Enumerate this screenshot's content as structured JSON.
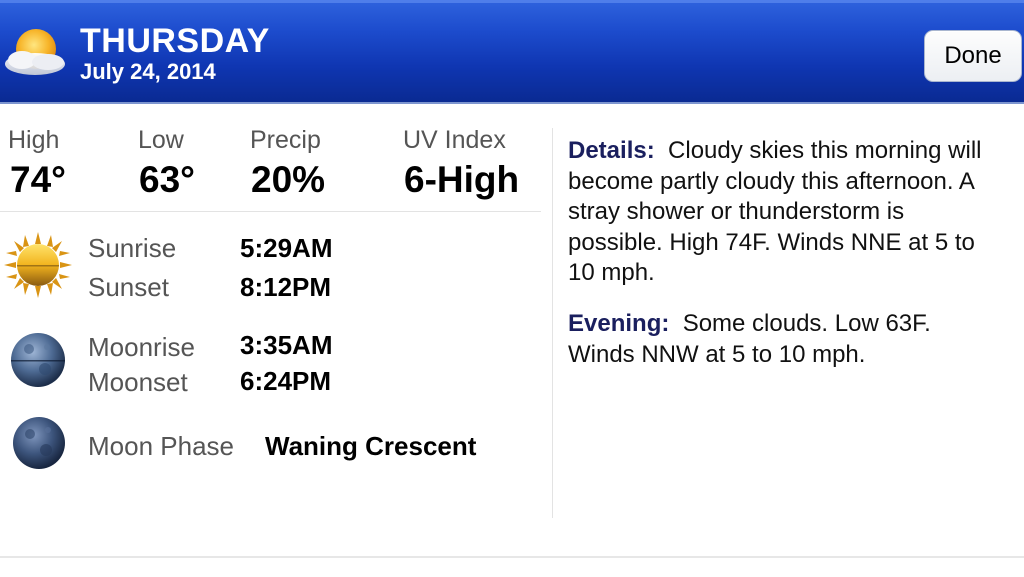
{
  "header": {
    "day": "THURSDAY",
    "date": "July 24, 2014",
    "done_label": "Done",
    "icon": "partly-cloudy-icon"
  },
  "stats": [
    {
      "label": "High",
      "value": "74°"
    },
    {
      "label": "Low",
      "value": "63°"
    },
    {
      "label": "Precip",
      "value": "20%"
    },
    {
      "label": "UV Index",
      "value": "6-High"
    }
  ],
  "sun": {
    "icon": "sun-icon",
    "sunrise_label": "Sunrise",
    "sunrise_value": "5:29AM",
    "sunset_label": "Sunset",
    "sunset_value": "8:12PM"
  },
  "moon": {
    "icon": "moon-icon",
    "moonrise_label": "Moonrise",
    "moonrise_value": "3:35AM",
    "moonset_label": "Moonset",
    "moonset_value": "6:24PM"
  },
  "phase": {
    "icon": "moon-phase-icon",
    "label": "Moon Phase",
    "value": "Waning Crescent"
  },
  "details": {
    "details_label": "Details:",
    "details_text": "Cloudy skies this morning will become partly cloudy this afternoon. A stray shower or thunderstorm is possible. High 74F. Winds NNE at 5 to 10 mph.",
    "evening_label": "Evening:",
    "evening_text": "Some clouds. Low 63F. Winds NNW at 5 to 10 mph."
  }
}
